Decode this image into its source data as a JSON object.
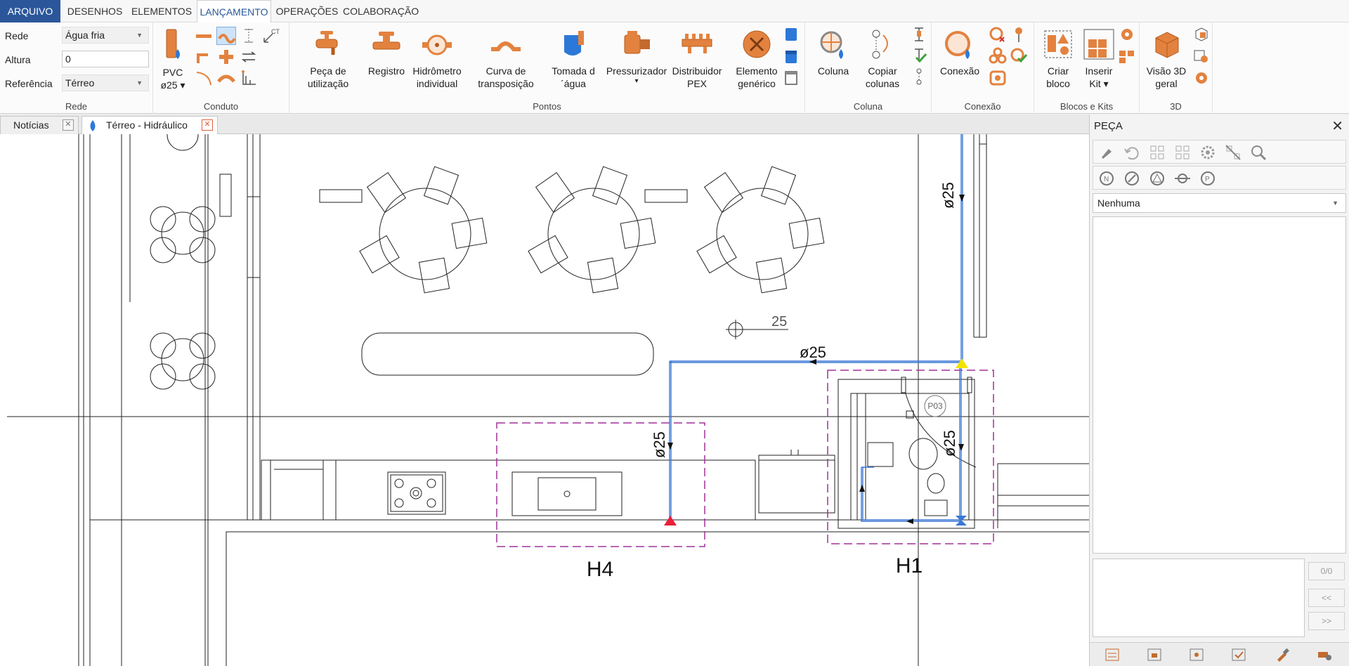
{
  "menu": {
    "tabs": [
      "ARQUIVO",
      "DESENHOS",
      "ELEMENTOS",
      "LANÇAMENTO",
      "OPERAÇÕES",
      "COLABORAÇÃO"
    ],
    "active": "LANÇAMENTO"
  },
  "ribbon": {
    "rede_group": {
      "title": "Rede",
      "rede_label": "Rede",
      "rede_value": "Água fria",
      "altura_label": "Altura",
      "altura_value": "0",
      "referencia_label": "Referência",
      "referencia_value": "Térreo"
    },
    "conduto_group": {
      "title": "Conduto",
      "pipe_line1": "PVC",
      "pipe_line2": "ø25",
      "ct_label": "CT"
    },
    "pontos_group": {
      "title": "Pontos",
      "buttons": [
        {
          "l1": "Peça de",
          "l2": "utilização"
        },
        {
          "l1": "Registro",
          "l2": ""
        },
        {
          "l1": "Hidrômetro",
          "l2": "individual"
        },
        {
          "l1": "Curva de",
          "l2": "transposição"
        },
        {
          "l1": "Tomada d",
          "l2": "´água"
        },
        {
          "l1": "Pressurizador",
          "l2": "▾"
        },
        {
          "l1": "Distribuidor",
          "l2": "PEX"
        },
        {
          "l1": "Elemento",
          "l2": "genérico"
        }
      ]
    },
    "coluna_group": {
      "title": "Coluna",
      "buttons": [
        {
          "l1": "Coluna",
          "l2": ""
        },
        {
          "l1": "Copiar",
          "l2": "colunas"
        }
      ]
    },
    "conexao_group": {
      "title": "Conexão",
      "buttons": [
        {
          "l1": "Conexão",
          "l2": ""
        }
      ]
    },
    "blocos_group": {
      "title": "Blocos e Kits",
      "buttons": [
        {
          "l1": "Criar",
          "l2": "bloco"
        },
        {
          "l1": "Inserir",
          "l2": "Kit ▾"
        }
      ]
    },
    "d3_group": {
      "title": "3D",
      "buttons": [
        {
          "l1": "Visão 3D",
          "l2": "geral"
        }
      ]
    }
  },
  "doc_tabs": [
    {
      "label": "Notícias",
      "active": false
    },
    {
      "label": "Térreo - Hidráulico",
      "active": true
    }
  ],
  "drawing": {
    "labels": {
      "pipe_top_right": "ø25",
      "pipe_horizontal": "ø25",
      "pipe_left_vertical": "ø25",
      "pipe_right_vertical": "ø25",
      "column_marker": "25",
      "room_tag": "P03",
      "zone_left": "H4",
      "zone_right": "H1"
    },
    "colors": {
      "pipe": "#3a77d6",
      "zone": "#a0309a",
      "endpoint_red": "#e8203a",
      "endpoint_yellow": "#f2e400"
    }
  },
  "panel": {
    "title": "PEÇA",
    "close": "✕",
    "select_value": "Nenhuma",
    "counter": "0/0",
    "prev": "<<",
    "next": ">>"
  }
}
